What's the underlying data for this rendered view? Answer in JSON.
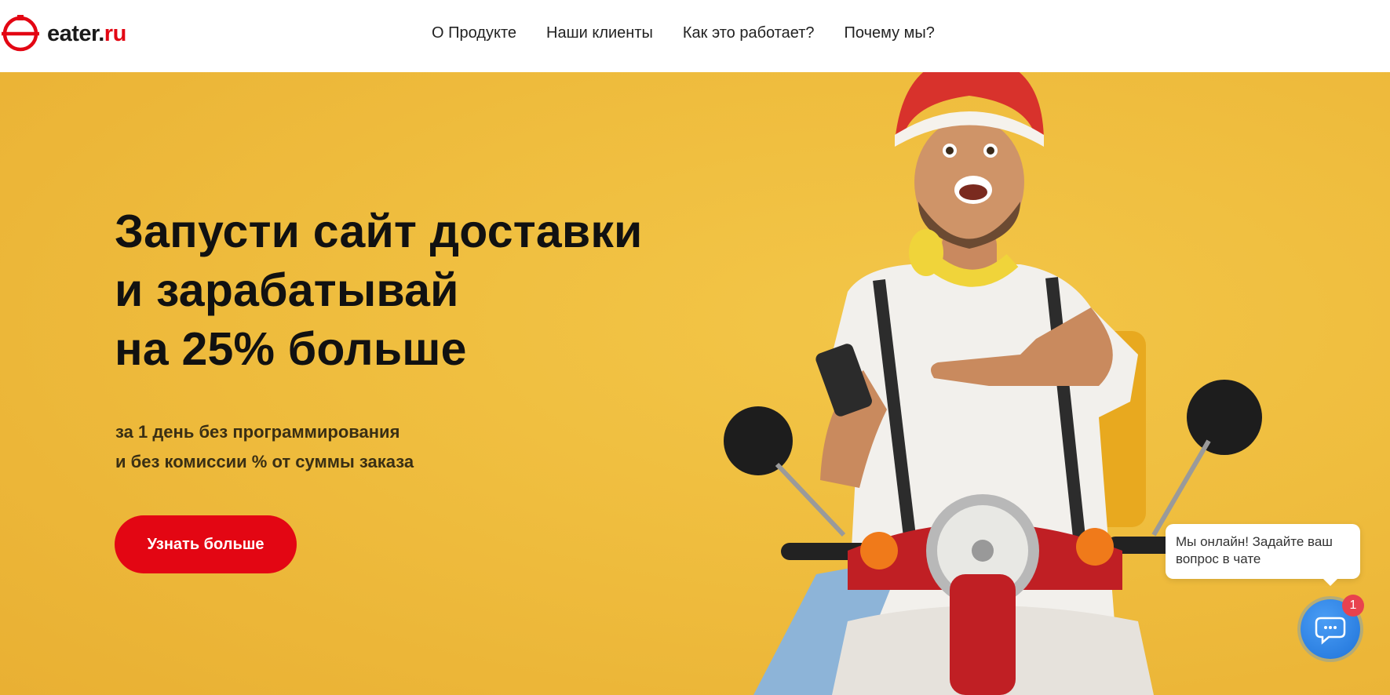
{
  "brand": {
    "logo_main": "eater.",
    "logo_accent": "ru",
    "accent_color": "#e30613"
  },
  "nav": {
    "items": [
      {
        "label": "О Продукте"
      },
      {
        "label": "Наши клиенты"
      },
      {
        "label": "Как это работает?"
      },
      {
        "label": "Почему мы?"
      }
    ]
  },
  "hero": {
    "title": "Запусти сайт доставки\nи зарабатывай\nна 25% больше",
    "subtitle": "за 1 день без программирования\nи без комиссии % от суммы заказа",
    "cta_label": "Узнать больше",
    "background_color": "#efbd3e",
    "image": "courier-on-scooter"
  },
  "chat": {
    "message": "Мы онлайн! Задайте ваш вопрос в чате",
    "badge_count": "1",
    "button_color": "#2a82e4",
    "icon": "chat-bubbles-icon"
  }
}
